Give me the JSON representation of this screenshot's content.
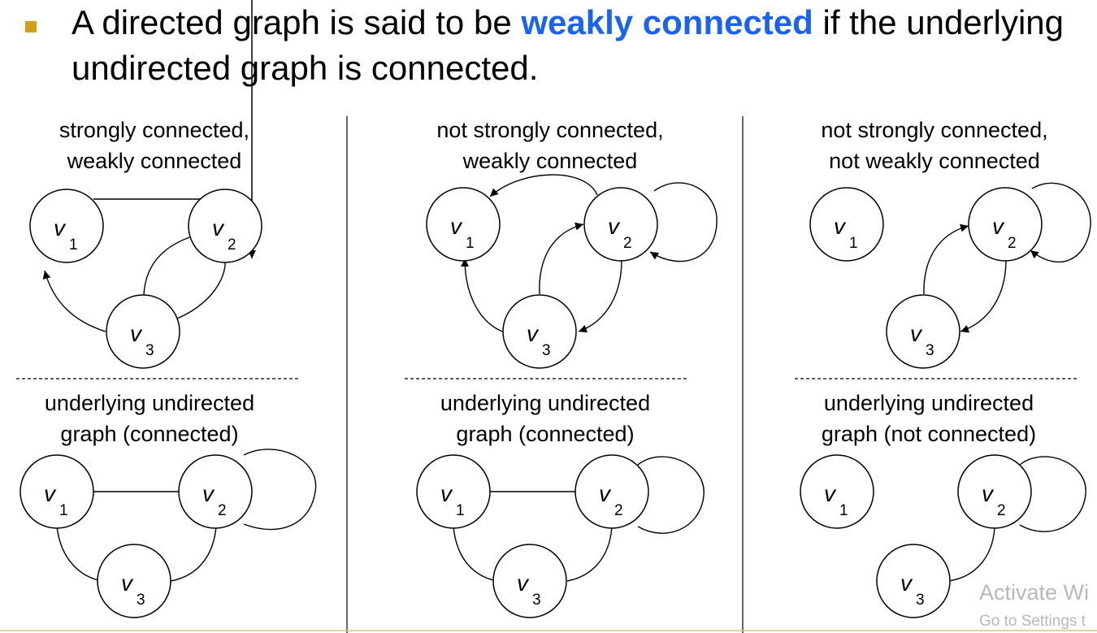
{
  "slide": {
    "bullet_color": "#d4a017",
    "headline": {
      "before": "A directed graph is said to be ",
      "highlight": "weakly connected",
      "after": " if the underlying undirected graph is connected.",
      "highlight_color": "#1a62f0"
    }
  },
  "panels": [
    {
      "directed_caption": [
        "strongly connected,",
        "weakly connected"
      ],
      "undirected_caption": [
        "underlying undirected",
        "graph (connected)"
      ]
    },
    {
      "directed_caption": [
        "not strongly connected,",
        "weakly connected"
      ],
      "undirected_caption": [
        "underlying undirected",
        "graph (connected)"
      ]
    },
    {
      "directed_caption": [
        "not strongly connected,",
        "not weakly connected"
      ],
      "undirected_caption": [
        "underlying undirected",
        "graph (not connected)"
      ]
    }
  ],
  "vertex": {
    "letter": "v",
    "subs": [
      "1",
      "2",
      "3"
    ]
  },
  "watermark": {
    "line1": "Activate Wi",
    "line2": "Go to Settings t"
  }
}
